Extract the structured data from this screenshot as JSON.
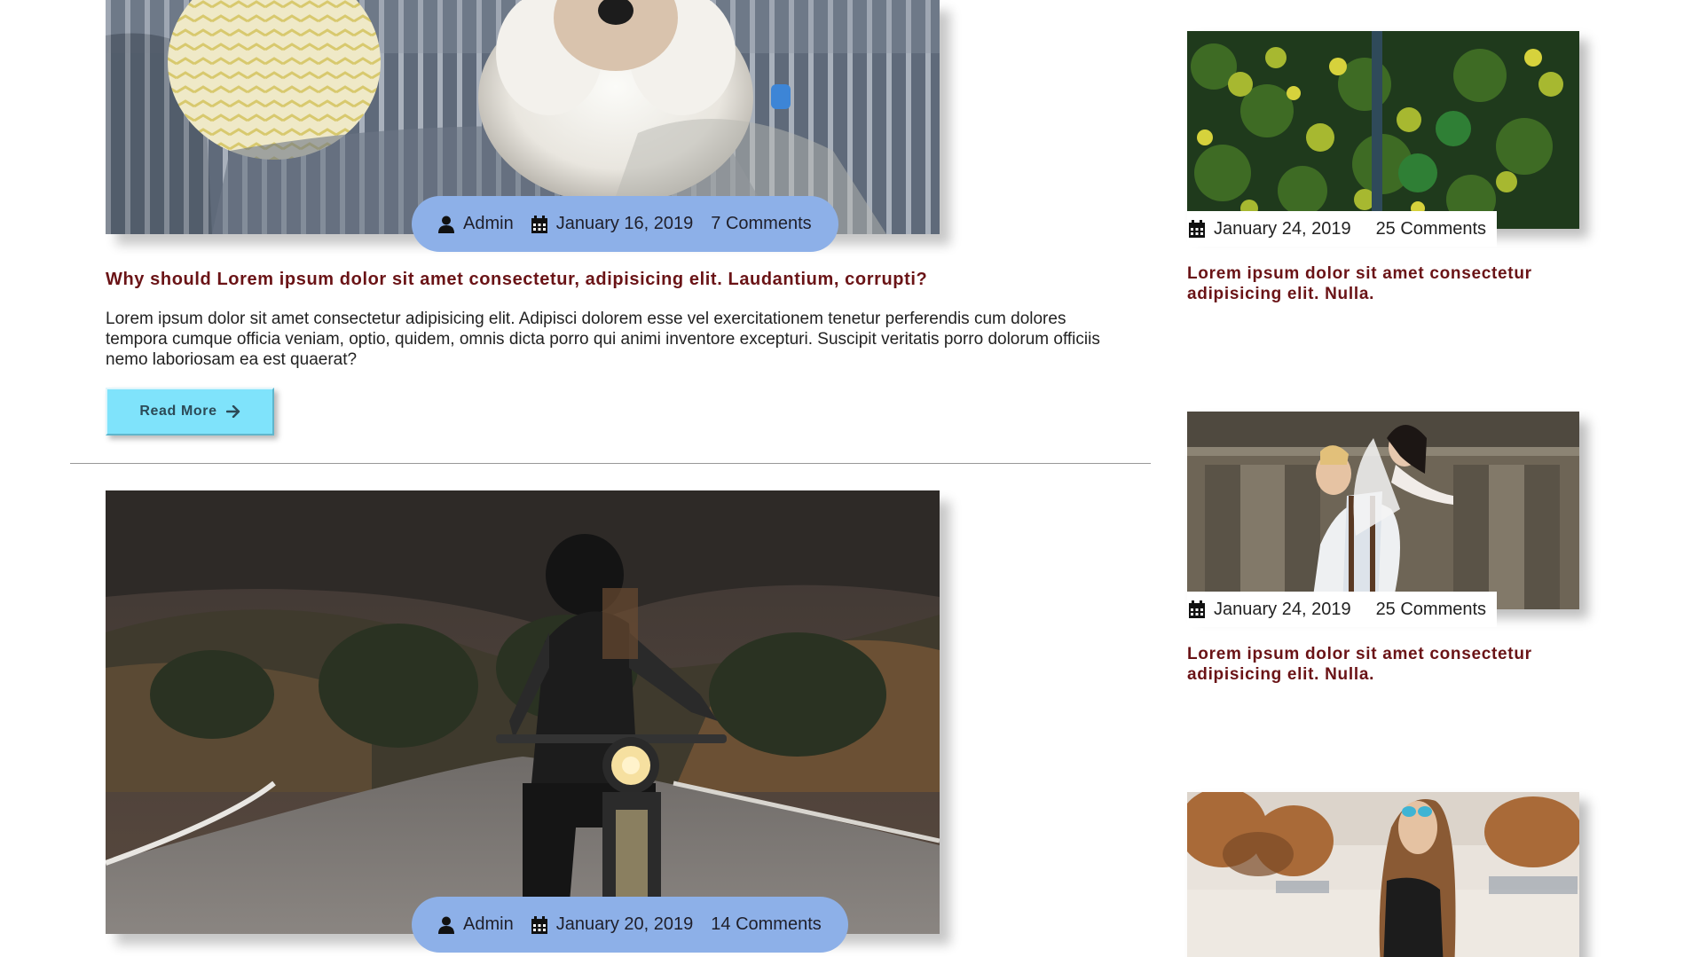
{
  "posts": [
    {
      "image_alt": "dog",
      "author": "Admin",
      "date": "January 16, 2019",
      "comments": "7 Comments",
      "title": "Why should Lorem ipsum dolor sit amet consectetur, adipisicing elit. Laudantium, corrupti?",
      "excerpt": "Lorem ipsum dolor sit amet consectetur adipisicing elit. Adipisci dolorem esse vel exercitationem tenetur perferendis cum dolores tempora cumque officia veniam, optio, quidem, omnis dicta porro qui animi inventore excepturi. Suscipit veritatis porro dolorum officiis nemo laboriosam ea est quaerat?",
      "read_more": "Read More"
    },
    {
      "image_alt": "motorcycle",
      "author": "Admin",
      "date": "January 20, 2019",
      "comments": "14 Comments"
    }
  ],
  "sidebar": [
    {
      "date": "January 24, 2019",
      "comments": "25 Comments",
      "title": "Lorem ipsum dolor sit amet consectetur adipisicing elit. Nulla."
    },
    {
      "date": "January 24, 2019",
      "comments": "25 Comments",
      "title": "Lorem ipsum dolor sit amet consectetur adipisicing elit. Nulla."
    },
    {
      "date": "",
      "comments": "",
      "title": ""
    }
  ],
  "colors": {
    "meta_pill": "#8db0e8",
    "title": "#6a1316",
    "read_more_bg": "#7fe3fb"
  },
  "icons": {
    "author": "user-icon",
    "date": "calendar-icon",
    "read_more": "arrow-right-icon"
  }
}
